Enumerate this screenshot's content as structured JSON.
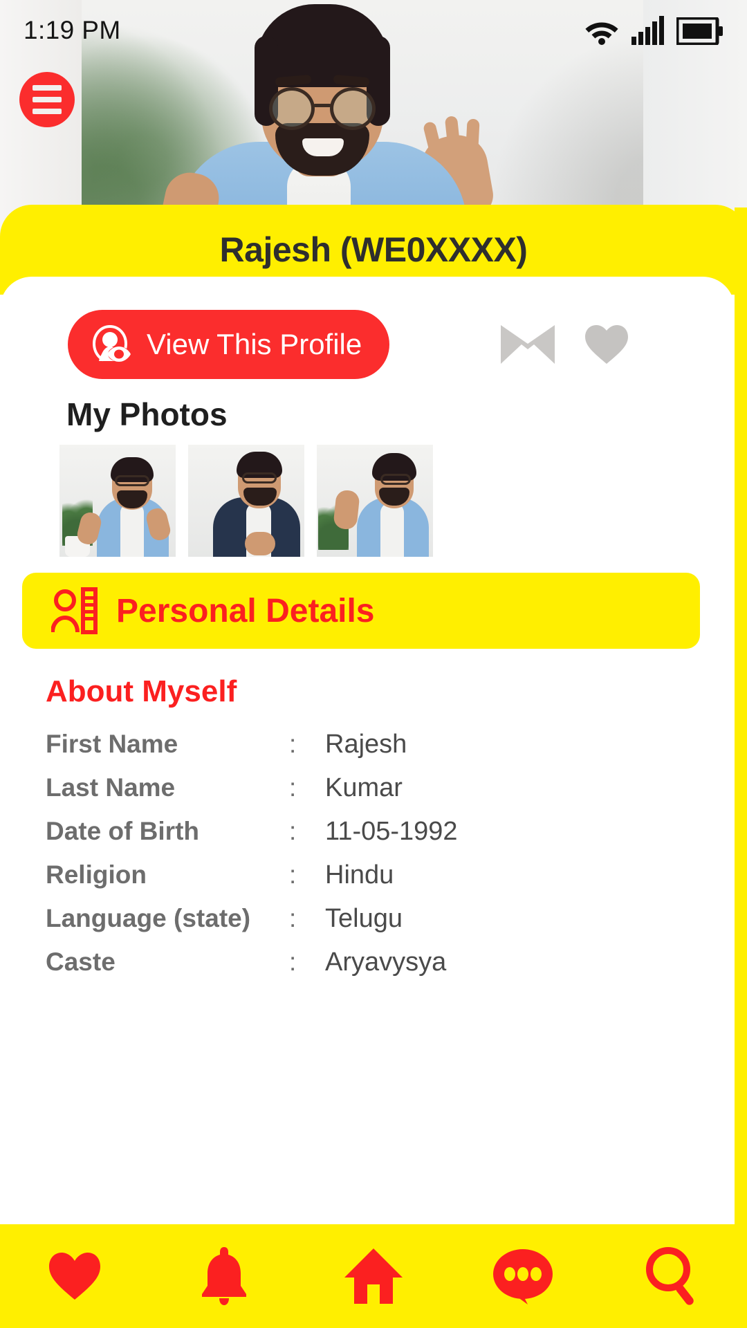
{
  "statusbar": {
    "time": "1:19 PM",
    "icons": [
      "wifi-icon",
      "cellular-signal-icon",
      "battery-icon"
    ]
  },
  "header": {
    "menu_icon": "hamburger-menu-icon",
    "profile_title": "Rajesh (WE0XXXX)"
  },
  "actions": {
    "view_profile_label": "View This Profile",
    "view_profile_icon": "profile-view-icon",
    "message_icon": "envelope-icon",
    "favorite_icon": "heart-icon"
  },
  "photos": {
    "heading": "My Photos",
    "items": [
      {
        "alt": "man in blue shirt gesturing with both hands"
      },
      {
        "alt": "man in dark denim jacket smiling"
      },
      {
        "alt": "man in blue shirt waving hand"
      }
    ]
  },
  "personal_details": {
    "banner_title": "Personal Details",
    "banner_icon": "contact-card-icon",
    "section_heading": "About Myself",
    "separator": ":",
    "rows": [
      {
        "label": "First Name",
        "value": "Rajesh"
      },
      {
        "label": "Last Name",
        "value": "Kumar"
      },
      {
        "label": "Date of Birth",
        "value": "11-05-1992"
      },
      {
        "label": "Religion",
        "value": "Hindu"
      },
      {
        "label": "Language (state)",
        "value": "Telugu"
      },
      {
        "label": "Caste",
        "value": "Aryavysya"
      }
    ]
  },
  "bottom_nav": [
    {
      "name": "nav-favorites",
      "icon": "heart-icon"
    },
    {
      "name": "nav-notifications",
      "icon": "bell-icon"
    },
    {
      "name": "nav-home",
      "icon": "home-icon"
    },
    {
      "name": "nav-chat",
      "icon": "chat-bubble-icon"
    },
    {
      "name": "nav-search",
      "icon": "search-icon"
    }
  ],
  "colors": {
    "brand_yellow": "#ffef00",
    "brand_red": "#fb2d2d",
    "label_gray": "#6d6d6d",
    "value_gray": "#4a4a4a"
  }
}
